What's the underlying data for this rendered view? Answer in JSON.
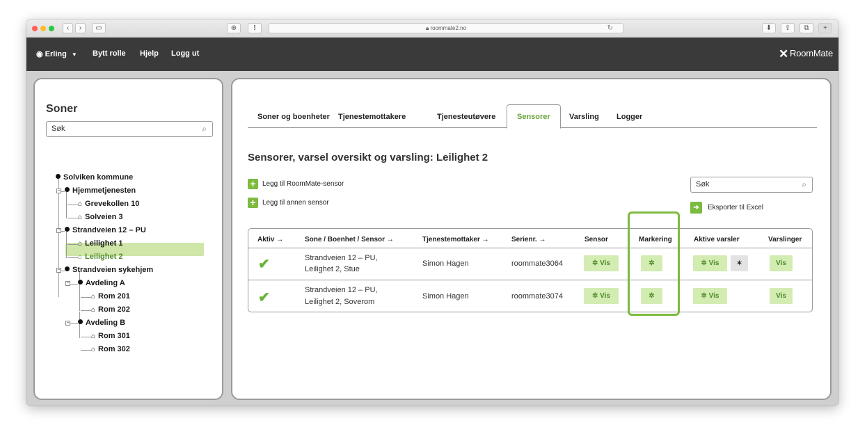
{
  "browser": {
    "url": "roommate2.no",
    "lock_glyph": "🔒"
  },
  "appbar": {
    "user": "Erling",
    "switch_role": "Bytt rolle",
    "help": "Hjelp",
    "logout": "Logg ut",
    "brand": "RoomMate"
  },
  "sidebar": {
    "title": "Soner",
    "search_placeholder": "Søk",
    "tree": [
      {
        "label": "Solviken kommune",
        "level": 0,
        "type": "zone"
      },
      {
        "label": "Hjemmetjenesten",
        "level": 1,
        "type": "zone"
      },
      {
        "label": "Grevekollen 10",
        "level": 2,
        "type": "unit"
      },
      {
        "label": "Solveien 3",
        "level": 2,
        "type": "unit"
      },
      {
        "label": "Strandveien 12 – PU",
        "level": 1,
        "type": "zone"
      },
      {
        "label": "Leilighet 1",
        "level": 2,
        "type": "unit"
      },
      {
        "label": "Leilighet 2",
        "level": 2,
        "type": "unit",
        "selected": true
      },
      {
        "label": "Strandveien sykehjem",
        "level": 1,
        "type": "zone"
      },
      {
        "label": "Avdeling A",
        "level": 2,
        "type": "zone"
      },
      {
        "label": "Rom 201",
        "level": 3,
        "type": "unit"
      },
      {
        "label": "Rom 202",
        "level": 3,
        "type": "unit"
      },
      {
        "label": "Avdeling B",
        "level": 2,
        "type": "zone"
      },
      {
        "label": "Rom 301",
        "level": 3,
        "type": "unit"
      },
      {
        "label": "Rom 302",
        "level": 3,
        "type": "unit"
      }
    ]
  },
  "tabs": [
    {
      "label": "Soner og boenheter"
    },
    {
      "label": "Tjenestemottakere"
    },
    {
      "label": "Tjenesteutøvere"
    },
    {
      "label": "Sensorer",
      "active": true
    },
    {
      "label": "Varsling"
    },
    {
      "label": "Logger"
    }
  ],
  "main": {
    "heading": "Sensorer, varsel oversikt og varsling: Leilighet 2",
    "add_roommate_sensor": "Legg til RoomMate-sensor",
    "add_other_sensor": "Legg til annen sensor",
    "search_placeholder": "Søk",
    "export_excel": "Eksporter til Excel"
  },
  "table": {
    "headers": {
      "active": "Aktiv →",
      "zone": "Sone / Boenhet / Sensor →",
      "recipient": "Tjenestemottaker →",
      "serial": "Serienr. →",
      "sensor": "Sensor",
      "marking": "Markering",
      "active_alerts": "Aktive varsler",
      "notifications": "Varslinger"
    },
    "rows": [
      {
        "zone_line1": "Strandveien 12 – PU,",
        "zone_line2": "Leilighet 2, Stue",
        "recipient": "Simon Hagen",
        "serial": "roommate3064",
        "sensor_btn": "Vis",
        "alerts_btn": "Vis",
        "notify_btn": "Vis",
        "has_fall_alert": true
      },
      {
        "zone_line1": "Strandveien 12 – PU,",
        "zone_line2": "Leilighet 2, Soverom",
        "recipient": "Simon Hagen",
        "serial": "roommate3074",
        "sensor_btn": "Vis",
        "alerts_btn": "Vis",
        "notify_btn": "Vis",
        "has_fall_alert": false
      }
    ]
  },
  "icons": {
    "check": "✔",
    "gear": "✲",
    "plus": "+",
    "house": "⌂",
    "search": "⌕"
  },
  "colors": {
    "accent": "#7cbb3f",
    "button_bg": "#d3ecb2",
    "selected_bg": "#cfe6a8",
    "header_bg": "#3a3a3a"
  }
}
